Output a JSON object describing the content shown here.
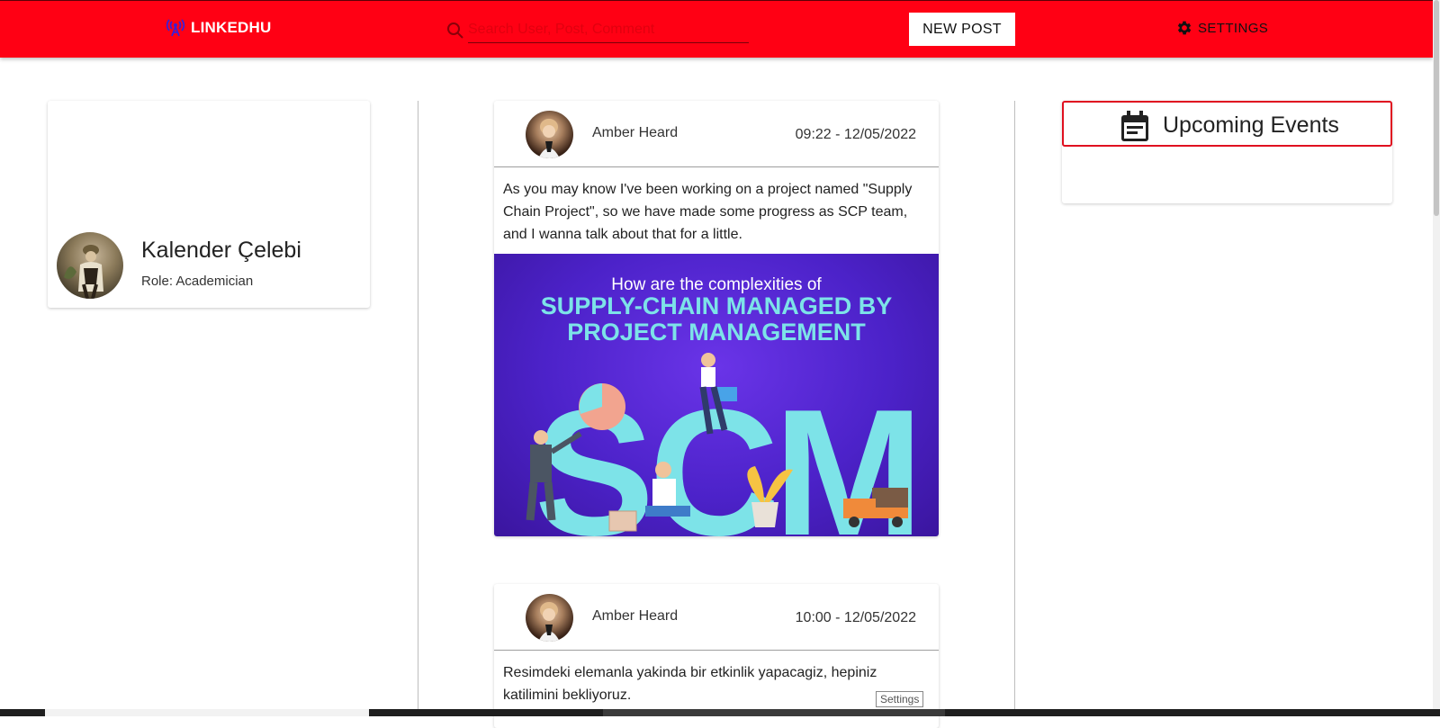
{
  "header": {
    "brand": "LINKEDHU",
    "search_placeholder": "Search User, Post, Comment",
    "new_post_label": "NEW POST",
    "settings_label": "SETTINGS",
    "accent_color": "#ff0014"
  },
  "profile": {
    "name": "Kalender Çelebi",
    "role": "Role: Academician"
  },
  "posts": [
    {
      "author": "Amber Heard",
      "time": "09:22 - 12/05/2022",
      "text": "As you may know I've been working on a project named \"Supply Chain Project\", so we have made some progress as SCP team, and I wanna talk about that for a little.",
      "image": {
        "line1": "How are the complexities of",
        "line2": "SUPPLY-CHAIN MANAGED BY",
        "line3": "PROJECT MANAGEMENT",
        "big_text": "SCM"
      }
    },
    {
      "author": "Amber Heard",
      "time": "10:00 - 12/05/2022",
      "text": "Resimdeki elemanla yakinda bir etkinlik yapacagiz, hepiniz katilimini bekliyoruz."
    }
  ],
  "events": {
    "title": "Upcoming Events"
  },
  "tooltip": "Settings"
}
